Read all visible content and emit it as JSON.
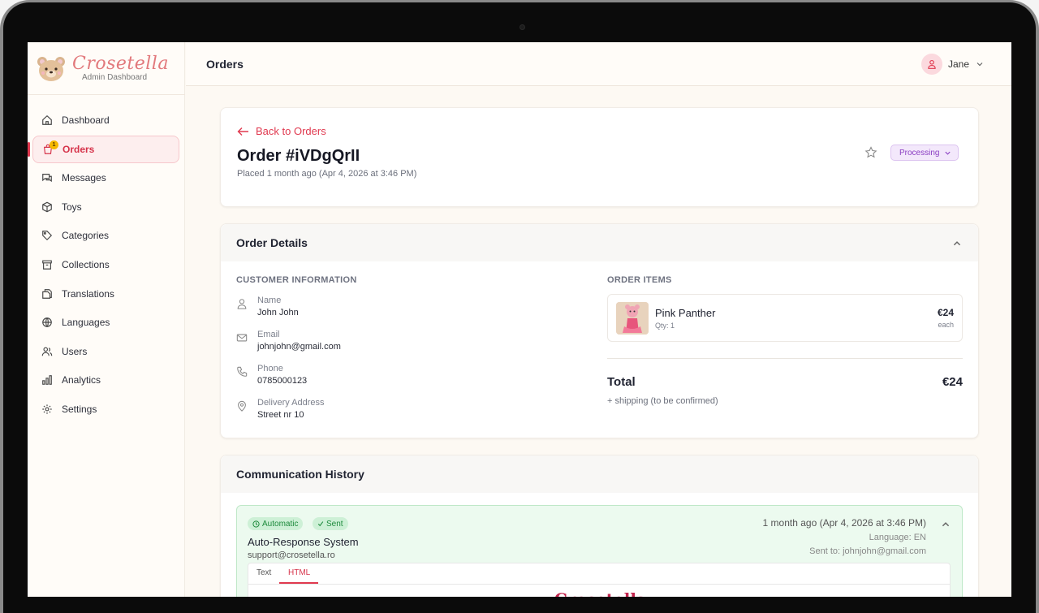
{
  "brand": {
    "name": "Crosetella",
    "subtitle": "Admin Dashboard"
  },
  "sidebar": {
    "items": [
      {
        "label": "Dashboard",
        "icon": "home-icon"
      },
      {
        "label": "Orders",
        "icon": "shopping-bag-icon",
        "active": true,
        "badge": "1"
      },
      {
        "label": "Messages",
        "icon": "messages-icon"
      },
      {
        "label": "Toys",
        "icon": "box-icon"
      },
      {
        "label": "Categories",
        "icon": "tag-icon"
      },
      {
        "label": "Collections",
        "icon": "archive-icon"
      },
      {
        "label": "Translations",
        "icon": "copy-icon"
      },
      {
        "label": "Languages",
        "icon": "globe-icon"
      },
      {
        "label": "Users",
        "icon": "users-icon"
      },
      {
        "label": "Analytics",
        "icon": "bar-chart-icon"
      },
      {
        "label": "Settings",
        "icon": "gear-icon"
      }
    ]
  },
  "header": {
    "title": "Orders",
    "user": "Jane"
  },
  "order": {
    "back_label": "Back to Orders",
    "title": "Order #iVDgQrII",
    "placed": "Placed 1 month ago (Apr 4, 2026 at 3:46 PM)",
    "status": "Processing"
  },
  "details": {
    "title": "Order Details",
    "customer_heading": "CUSTOMER INFORMATION",
    "fields": [
      {
        "key": "Name",
        "value": "John John",
        "icon": "user-icon"
      },
      {
        "key": "Email",
        "value": "johnjohn@gmail.com",
        "icon": "mail-icon"
      },
      {
        "key": "Phone",
        "value": "0785000123",
        "icon": "phone-icon"
      },
      {
        "key": "Delivery Address",
        "value": "Street nr 10",
        "icon": "map-pin-icon"
      }
    ],
    "items_heading": "ORDER ITEMS",
    "items": [
      {
        "name": "Pink Panther",
        "qty": "Qty: 1",
        "price": "€24",
        "unit": "each"
      }
    ],
    "total_label": "Total",
    "total_value": "€24",
    "shipping_note": "+ shipping (to be confirmed)"
  },
  "communication": {
    "title": "Communication History",
    "message": {
      "tag_auto": "Automatic",
      "tag_sent": "Sent",
      "from": "Auto-Response System",
      "email": "support@crosetella.ro",
      "time": "1 month ago (Apr 4, 2026 at 3:46 PM)",
      "language": "Language: EN",
      "sent_to": "Sent to: johnjohn@gmail.com",
      "tabs": [
        "Text",
        "HTML"
      ],
      "active_tab": "HTML",
      "preview_title": "Crosetella"
    }
  },
  "colors": {
    "accent": "#e0394f",
    "status_bg": "#f3e8fb",
    "sent_green": "#1d8a3c"
  }
}
